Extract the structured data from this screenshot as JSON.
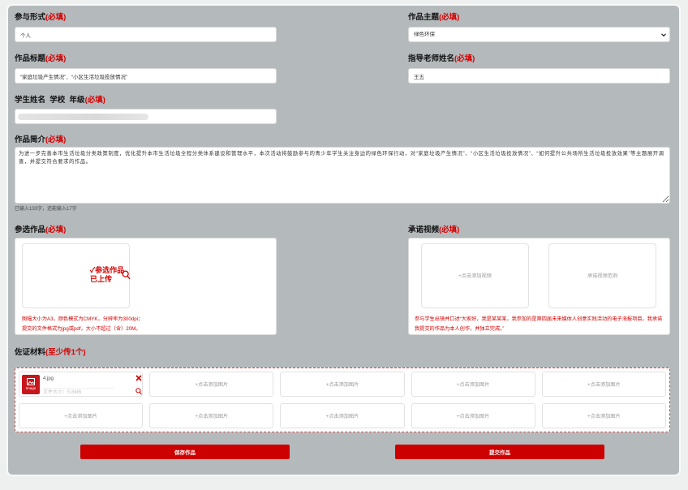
{
  "form": {
    "participation": {
      "label": "参与形式",
      "required": "(必填)",
      "value": "个人"
    },
    "theme": {
      "label": "作品主题",
      "required": "(必填)",
      "value": "绿色环保"
    },
    "title": {
      "label": "作品标题",
      "required": "(必填)",
      "value": "“家庭垃圾产生情况”、“小区生活垃圾投放情况”"
    },
    "teacher": {
      "label": "指导老师姓名",
      "required": "(必填)",
      "value": "王五"
    },
    "student": {
      "label": "学生姓名  学校  年级",
      "required": "(必填)"
    },
    "intro": {
      "label": "作品简介",
      "required": "(必填)",
      "value": "为进一步完善本市生活垃圾分类政策制度，优化提升本市生活垃圾全程分类体系建设和管理水平，本次活动将鼓励参与的青少年学生关注身边的绿色环保行动，对“家庭垃圾产生情况”、“小区生活垃圾投放情况”、“如何提升公共场所生活垃圾投放效果”等主题展开调查，并提交符合要求的作品。",
      "counter": "已输入133字，还能输入17字"
    },
    "entry": {
      "label": "参选作品",
      "required": "(必填)",
      "status_line1": "✓参选作品",
      "status_line2": "已上传",
      "note_line1": "图幅大小为A3，颜色模式为CMYK，分辨率为300dpi；",
      "note_line2": "提交的文件格式为jpg或pdf，大小不超过（含）20M。"
    },
    "video": {
      "label": "承诺视频",
      "required": "(必填)",
      "add_label": "+点击添加视频",
      "example_label": "承诺视频范例",
      "note_line1": "参与学生出镜并口述“大家好，我是某某某，我参加的是第四届未来媒体人创意实践活动的电子海报项目。我承诺",
      "note_line2": "我提交的作品为本人创作，并独立完成。”"
    },
    "evidence": {
      "label": "佐证材料",
      "required": "(至少传1个)",
      "file": {
        "thumb_label": "Image",
        "name": "4.jpg",
        "meta": "文件大小：5.8MB"
      },
      "slots": [
        "+点击添加图片",
        "+点击添加图片",
        "+点击添加图片",
        "+点击添加图片",
        "+点击添加图片",
        "+点击添加图片",
        "+点击添加图片",
        "+点击添加图片",
        "+点击添加图片"
      ]
    }
  },
  "actions": {
    "save": "保存作品",
    "submit": "提交作品"
  },
  "colors": {
    "accent": "#d40000",
    "button": "#cc0000",
    "panel": "#b4b9bc"
  },
  "icons": [
    "chevron-down-icon",
    "search-icon",
    "close-icon",
    "image-file-icon"
  ]
}
